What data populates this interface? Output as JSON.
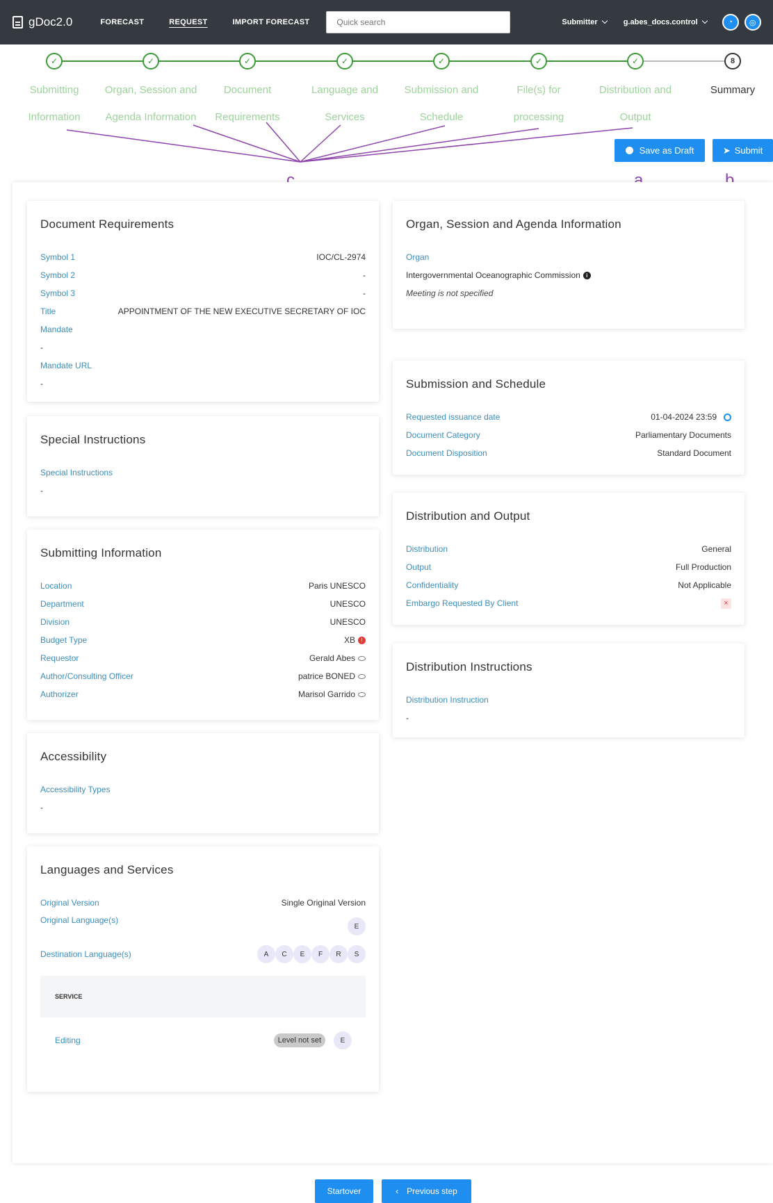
{
  "topbar": {
    "brand": "gDoc2.0",
    "nav": [
      "FORECAST",
      "REQUEST",
      "IMPORT FORECAST"
    ],
    "search_placeholder": "Quick search",
    "role": "Submitter",
    "user": "g.abes_docs.control"
  },
  "stepper": {
    "steps": [
      {
        "line1": "Submitting",
        "line2": "Information"
      },
      {
        "line1": "Organ, Session and",
        "line2": "Agenda Information"
      },
      {
        "line1": "Document",
        "line2": "Requirements"
      },
      {
        "line1": "Language and",
        "line2": "Services"
      },
      {
        "line1": "Submission and",
        "line2": "Schedule"
      },
      {
        "line1": "File(s) for",
        "line2": "processing"
      },
      {
        "line1": "Distribution and",
        "line2": "Output"
      },
      {
        "line1": "Summary",
        "line2": ""
      }
    ],
    "current_number": "8"
  },
  "annotations": {
    "a": "a.",
    "b": "b.",
    "c": "c."
  },
  "actions": {
    "save_draft": "Save as Draft",
    "submit": "Submit"
  },
  "doc_req": {
    "title": "Document Requirements",
    "rows": [
      {
        "k": "Symbol 1",
        "v": "IOC/CL-2974"
      },
      {
        "k": "Symbol 2",
        "v": "-"
      },
      {
        "k": "Symbol 3",
        "v": "-"
      },
      {
        "k": "Title",
        "v": "APPOINTMENT OF THE NEW EXECUTIVE SECRETARY OF IOC"
      }
    ],
    "mandate_label": "Mandate",
    "mandate_value": "-",
    "mandate_url_label": "Mandate URL",
    "mandate_url_value": "-"
  },
  "special": {
    "title": "Special Instructions",
    "label": "Special Instructions",
    "value": "-"
  },
  "submitting": {
    "title": "Submitting Information",
    "rows": [
      {
        "k": "Location",
        "v": "Paris UNESCO"
      },
      {
        "k": "Department",
        "v": "UNESCO"
      },
      {
        "k": "Division",
        "v": "UNESCO"
      },
      {
        "k": "Budget Type",
        "v": "XB"
      },
      {
        "k": "Requestor",
        "v": "Gerald Abes"
      },
      {
        "k": "Author/Consulting Officer",
        "v": "patrice BONED"
      },
      {
        "k": "Authorizer",
        "v": "Marisol Garrido"
      }
    ]
  },
  "accessibility": {
    "title": "Accessibility",
    "label": "Accessibility Types",
    "value": "-"
  },
  "languages": {
    "title": "Languages and Services",
    "original_version_label": "Original Version",
    "original_version_value": "Single Original Version",
    "original_lang_label": "Original Language(s)",
    "original_langs": [
      "E"
    ],
    "dest_lang_label": "Destination Language(s)",
    "dest_langs": [
      "A",
      "C",
      "E",
      "F",
      "R",
      "S"
    ],
    "service_header": "SERVICE",
    "service_name": "Editing",
    "service_level": "Level not set",
    "service_lang": "E"
  },
  "organ": {
    "title": "Organ, Session and Agenda Information",
    "label": "Organ",
    "value": "Intergovernmental Oceanographic Commission",
    "note": "Meeting is not specified"
  },
  "schedule": {
    "title": "Submission and Schedule",
    "rows": [
      {
        "k": "Requested issuance date",
        "v": "01-04-2024 23:59"
      },
      {
        "k": "Document Category",
        "v": "Parliamentary Documents"
      },
      {
        "k": "Document Disposition",
        "v": "Standard Document"
      }
    ]
  },
  "distribution": {
    "title": "Distribution and Output",
    "rows": [
      {
        "k": "Distribution",
        "v": "General"
      },
      {
        "k": "Output",
        "v": "Full Production"
      },
      {
        "k": "Confidentiality",
        "v": "Not Applicable"
      },
      {
        "k": "Embargo Requested By Client",
        "v": "×"
      }
    ]
  },
  "dist_instr": {
    "title": "Distribution Instructions",
    "label": "Distribution Instruction",
    "value": "-"
  },
  "footer": {
    "startover": "Startover",
    "previous": "Previous step"
  }
}
